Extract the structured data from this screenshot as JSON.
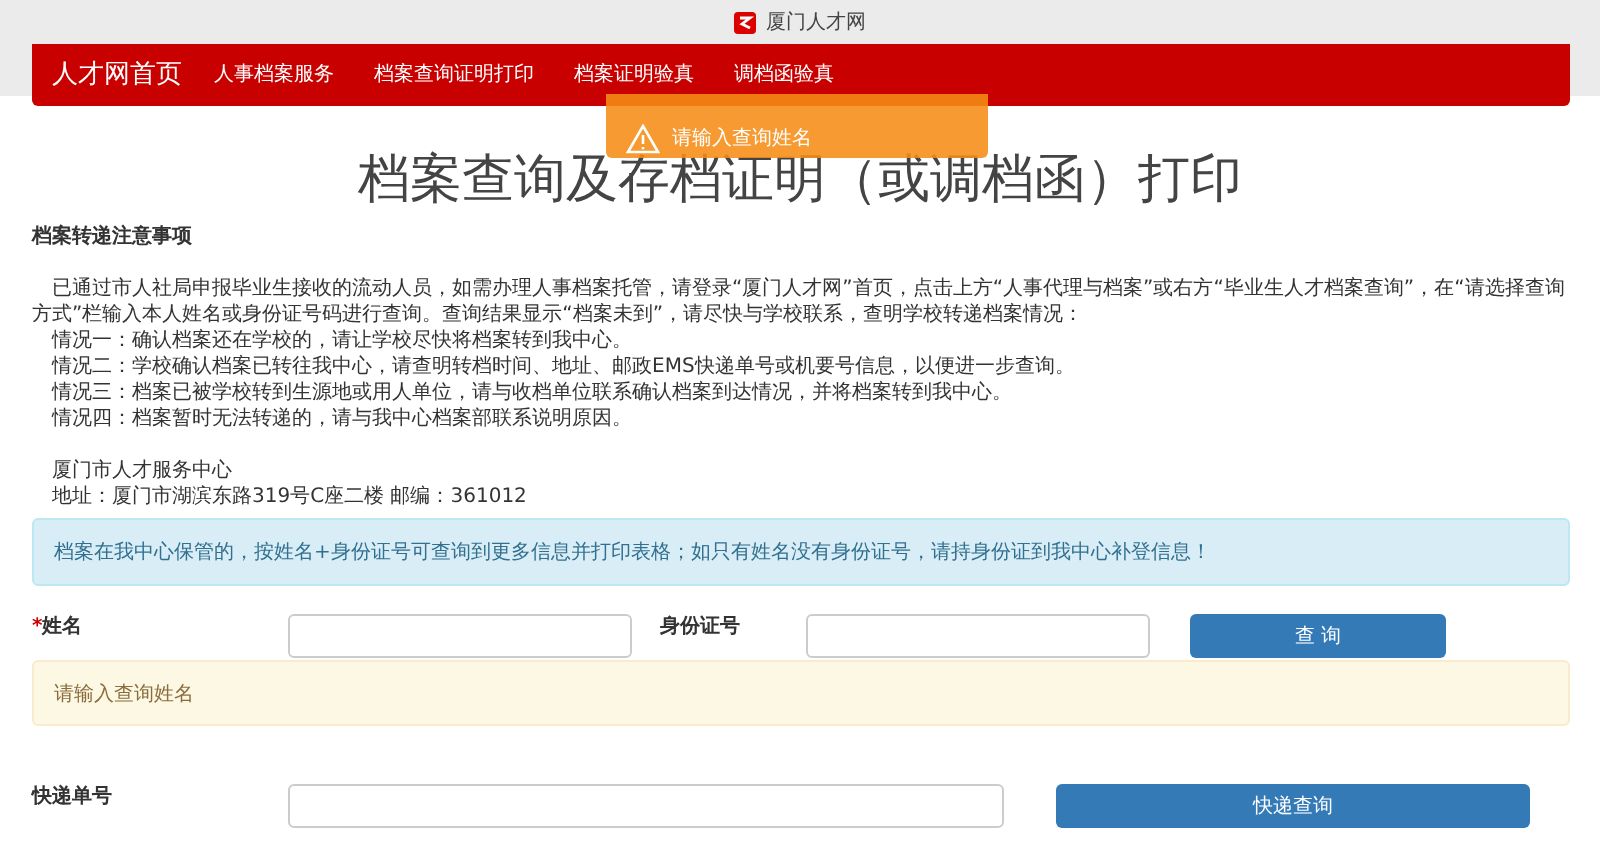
{
  "window": {
    "title": "厦门人才网"
  },
  "nav": {
    "brand": "人才网首页",
    "items": [
      {
        "label": "人事档案服务"
      },
      {
        "label": "档案查询证明打印"
      },
      {
        "label": "档案证明验真"
      },
      {
        "label": "调档函验真"
      }
    ]
  },
  "toast": {
    "message": "请输入查询姓名"
  },
  "heading": "档案查询及存档证明（或调档函）打印",
  "notice": {
    "title": "档案转递注意事项",
    "intro": "已通过市人社局申报毕业生接收的流动人员，如需办理人事档案托管，请登录“厦门人才网”首页，点击上方“人事代理与档案”或右方“毕业生人才档案查询”，在“请选择查询方式”栏输入本人姓名或身份证号码进行查询。查询结果显示“档案未到”，请尽快与学校联系，查明学校转递档案情况：",
    "cases": [
      "情况一：确认档案还在学校的，请让学校尽快将档案转到我中心。",
      "情况二：学校确认档案已转往我中心，请查明转档时间、地址、邮政EMS快递单号或机要号信息，以便进一步查询。",
      "情况三：档案已被学校转到生源地或用人单位，请与收档单位联系确认档案到达情况，并将档案转到我中心。",
      "情况四：档案暂时无法转递的，请与我中心档案部联系说明原因。"
    ],
    "org": "厦门市人才服务中心",
    "address": "地址：厦门市湖滨东路319号C座二楼 邮编：361012"
  },
  "info_alert": "档案在我中心保管的，按姓名+身份证号可查询到更多信息并打印表格；如只有姓名没有身份证号，请持身份证到我中心补登信息！",
  "query_form": {
    "fields": [
      {
        "label": "姓名",
        "required_mark": "*"
      },
      {
        "label": "身份证号"
      }
    ],
    "button": "查 询"
  },
  "warning_alert": "请输入查询姓名",
  "express_form": {
    "label": "快递单号",
    "button": "快递查询"
  }
}
